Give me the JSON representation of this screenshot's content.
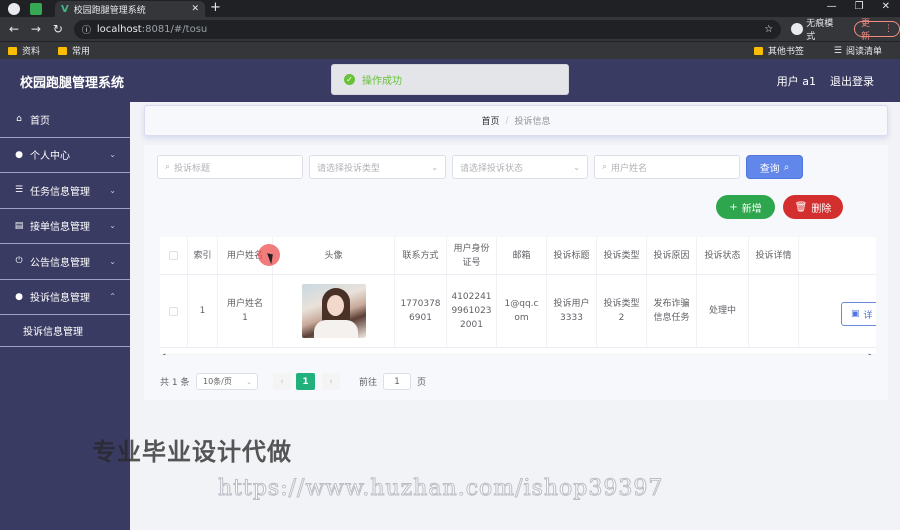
{
  "browser": {
    "tab_title": "校园跑腿管理系统",
    "url_host": "localhost",
    "url_path": ":8081/#/tosu",
    "incognito_label": "无痕模式",
    "update_label": "更新",
    "bookmarks": [
      "资料",
      "常用"
    ],
    "bookmarks_right": [
      "其他书签",
      "阅读清单"
    ]
  },
  "header": {
    "title": "校园跑腿管理系统",
    "user_label": "用户 a1",
    "logout_label": "退出登录"
  },
  "toast": {
    "message": "操作成功"
  },
  "sidebar": {
    "items": [
      {
        "label": "首页",
        "icon": "home-icon"
      },
      {
        "label": "个人中心",
        "icon": "user-icon"
      },
      {
        "label": "任务信息管理",
        "icon": "list-icon"
      },
      {
        "label": "接单信息管理",
        "icon": "clipboard-icon"
      },
      {
        "label": "公告信息管理",
        "icon": "power-icon"
      },
      {
        "label": "投诉信息管理",
        "icon": "user-icon"
      }
    ],
    "sub_item": "投诉信息管理"
  },
  "breadcrumb": {
    "home": "首页",
    "separator": "/",
    "current": "投诉信息"
  },
  "filters": {
    "title_placeholder": "投诉标题",
    "type_placeholder": "请选择投诉类型",
    "status_placeholder": "请选择投诉状态",
    "username_placeholder": "用户姓名",
    "search_label": "查询"
  },
  "actions": {
    "add_label": "新增",
    "delete_label": "删除"
  },
  "table": {
    "headers": [
      "索引",
      "用户姓名",
      "头像",
      "联系方式",
      "用户身份\n证号",
      "邮箱",
      "投诉标题",
      "投诉类型",
      "投诉原因",
      "投诉状态",
      "投诉详情"
    ],
    "rows": [
      {
        "index": "1",
        "username": "用户姓名\n1",
        "contact": "1770378\n6901",
        "id_number": "4102241\n9961023\n2001",
        "email": "1@qq.c\nom",
        "title": "投诉用户\n3333",
        "type": "投诉类型\n2",
        "reason": "发布诈骗\n信息任务",
        "status": "处理中",
        "detail_label": "详"
      }
    ]
  },
  "pagination": {
    "total": "共 1 条",
    "page_size": "10条/页",
    "current_page": "1",
    "goto_label": "前往",
    "goto_value": "1",
    "page_suffix": "页"
  },
  "watermark": {
    "line1": "专业毕业设计代做",
    "line2": "https://www.huzhan.com/ishop39397"
  },
  "colors": {
    "sidebar_bg": "#3a3b63",
    "primary": "#6287ea",
    "success": "#2ea64d",
    "danger": "#d42f2f",
    "page_active": "#22b07d"
  }
}
